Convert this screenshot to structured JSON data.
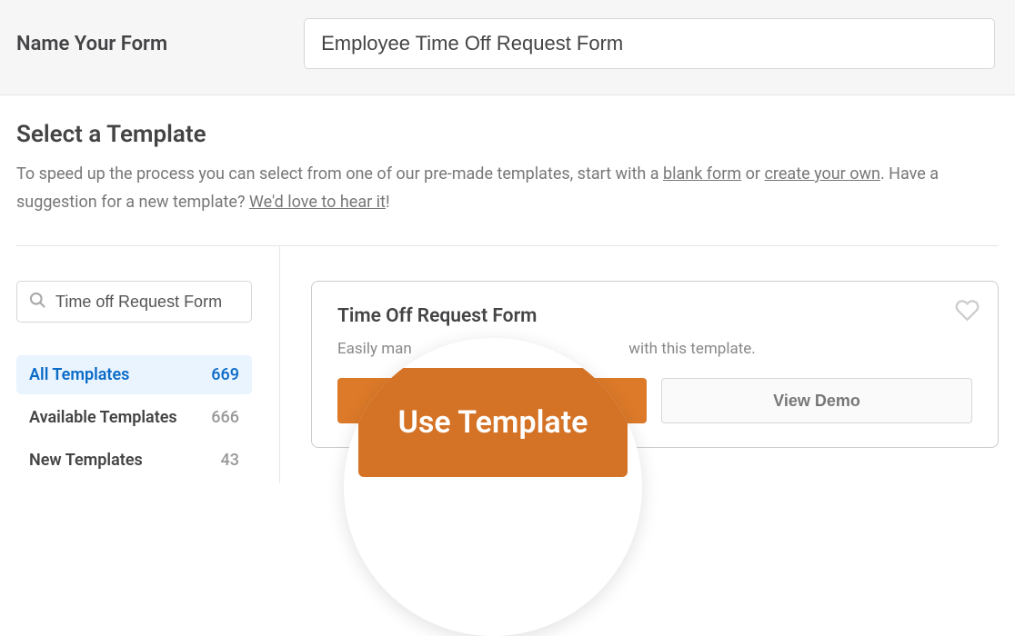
{
  "form_name": {
    "label": "Name Your Form",
    "value": "Employee Time Off Request Form"
  },
  "select_template": {
    "title": "Select a Template",
    "desc_part1": "To speed up the process you can select from one of our pre-made templates, start with a ",
    "link_blank": "blank form",
    "desc_or": " or ",
    "link_create": "create your own",
    "desc_part2": ". Have a suggestion for a new template? ",
    "link_hear": "We'd love to hear it",
    "desc_end": "!"
  },
  "search": {
    "value": "Time off Request Form"
  },
  "filters": [
    {
      "label": "All Templates",
      "count": "669",
      "active": true
    },
    {
      "label": "Available Templates",
      "count": "666",
      "active": false
    },
    {
      "label": "New Templates",
      "count": "43",
      "active": false
    }
  ],
  "template_card": {
    "title": "Time Off Request Form",
    "desc_visible_left": "Easily man",
    "desc_visible_right": "with this template.",
    "use_label": "Use Template",
    "view_label": "View Demo"
  },
  "zoom_label": "Use Template"
}
